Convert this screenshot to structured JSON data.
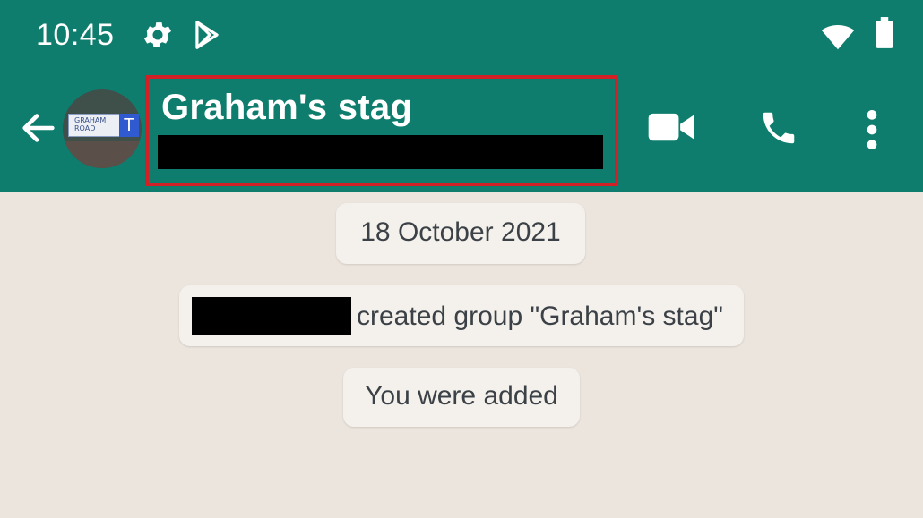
{
  "status_bar": {
    "time": "10:45",
    "icons": [
      "gear-icon",
      "play-store-icon",
      "wifi-icon",
      "battery-icon"
    ]
  },
  "header": {
    "group_name": "Graham's stag",
    "subtitle_redacted": true,
    "avatar_text": "GRAHAM ROAD",
    "avatar_badge": "T",
    "actions": [
      "video-call-icon",
      "phone-icon",
      "more-vert-icon"
    ]
  },
  "chat": {
    "date_label": "18 October 2021",
    "system_message": "created group \"Graham's stag\"",
    "added_message": "You were added"
  },
  "colors": {
    "header": "#0f7d6d",
    "chat_background": "#ece5dd",
    "highlight_box": "#d12026",
    "bubble": "#f4f1ec"
  }
}
